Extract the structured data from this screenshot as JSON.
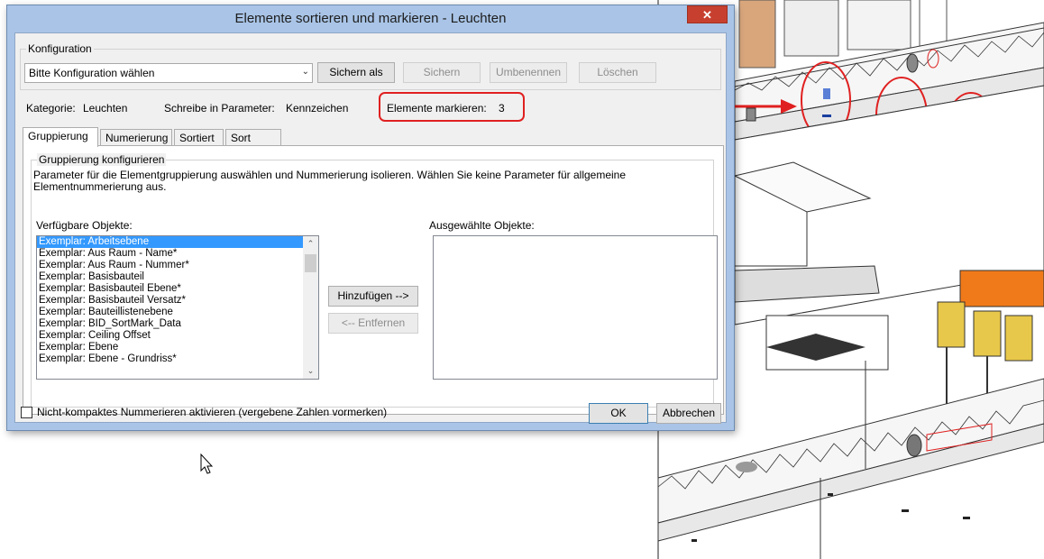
{
  "dialog": {
    "title": "Elemente sortieren und markieren - Leuchten",
    "close_label": "✕"
  },
  "config": {
    "legend": "Konfiguration",
    "combo_value": "Bitte Konfiguration wählen",
    "save_as": "Sichern als",
    "save": "Sichern",
    "rename": "Umbenennen",
    "delete": "Löschen"
  },
  "info": {
    "category_label": "Kategorie:",
    "category_value": "Leuchten",
    "param_label": "Schreibe in Parameter:",
    "param_value": "Kennzeichen",
    "mark_label": "Elemente markieren:",
    "mark_value": "3"
  },
  "tabs": [
    "Gruppierung",
    "Numerierung",
    "Sortiert",
    "Sort Mark"
  ],
  "grouping": {
    "legend": "Gruppierung konfigurieren",
    "description": "Parameter für die Elementgruppierung auswählen und Nummerierung isolieren. Wählen Sie keine Parameter für allgemeine Elementnummerierung aus.",
    "available_label": "Verfügbare Objekte:",
    "selected_label": "Ausgewählte Objekte:",
    "add_button": "Hinzufügen -->",
    "remove_button": "<-- Entfernen",
    "available_items": [
      "Exemplar: Arbeitsebene",
      "Exemplar: Aus Raum - Name*",
      "Exemplar: Aus Raum - Nummer*",
      "Exemplar: Basisbauteil",
      "Exemplar: Basisbauteil Ebene*",
      "Exemplar: Basisbauteil Versatz*",
      "Exemplar: Bauteillistenebene",
      "Exemplar: BID_SortMark_Data",
      "Exemplar: Ceiling Offset",
      "Exemplar: Ebene",
      "Exemplar: Ebene - Grundriss*"
    ],
    "selected_items": []
  },
  "footer": {
    "checkbox_label": "Nicht-kompaktes Nummerieren aktivieren (vergebene Zahlen vormerken)",
    "ok": "OK",
    "cancel": "Abbrechen"
  },
  "colors": {
    "annotation_red": "#e02020",
    "selection_blue": "#3399ff",
    "accent_orange": "#f07a1a"
  }
}
